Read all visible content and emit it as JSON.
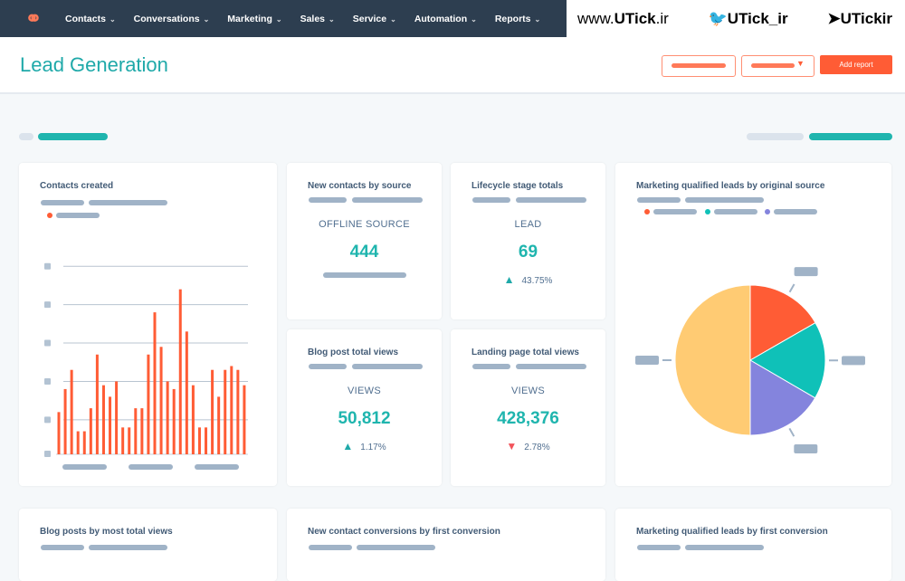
{
  "nav": {
    "logo_icon": "hubspot-sprocket-icon",
    "items": [
      "Contacts",
      "Conversations",
      "Marketing",
      "Sales",
      "Service",
      "Automation",
      "Reports"
    ]
  },
  "watermark": {
    "site_prefix": "www.",
    "site_bold": "UTick",
    "site_suffix": ".ir",
    "twitter": "UTick_ir",
    "telegram": "UTickir"
  },
  "header": {
    "title": "Lead Generation",
    "add_report": "Add report"
  },
  "colors": {
    "accent": "#1fb5ae",
    "orange": "#ff5c35",
    "teal": "#0fc1b8",
    "purple": "#8484dd",
    "yellow": "#ffcb73"
  },
  "cards": {
    "contacts_created": {
      "title": "Contacts created"
    },
    "new_contacts": {
      "title": "New contacts by source",
      "label": "OFFLINE SOURCE",
      "value": "444"
    },
    "lifecycle": {
      "title": "Lifecycle stage totals",
      "label": "LEAD",
      "value": "69",
      "change": "43.75%",
      "direction": "up"
    },
    "blog_views": {
      "title": "Blog post total views",
      "label": "VIEWS",
      "value": "50,812",
      "change": "1.17%",
      "direction": "up"
    },
    "landing_views": {
      "title": "Landing page total views",
      "label": "VIEWS",
      "value": "428,376",
      "change": "2.78%",
      "direction": "down"
    },
    "mql_source": {
      "title": "Marketing qualified leads by original source"
    },
    "blog_posts": {
      "title": "Blog posts by most total views"
    },
    "conversions": {
      "title": "New contact conversions by first conversion"
    },
    "mql_first": {
      "title": "Marketing qualified leads by first conversion"
    }
  },
  "chart_data": [
    {
      "type": "bar",
      "title": "Contacts created",
      "ylim": [
        0,
        5
      ],
      "grid": true,
      "color": "#ff5c35",
      "values": [
        1.1,
        1.7,
        2.2,
        0.6,
        0.6,
        1.2,
        2.6,
        1.8,
        1.5,
        1.9,
        0.7,
        0.7,
        1.2,
        1.2,
        2.6,
        3.7,
        2.8,
        1.9,
        1.7,
        4.3,
        3.2,
        1.8,
        0.7,
        0.7,
        2.2,
        1.5,
        2.2,
        2.3,
        2.2,
        1.8
      ]
    },
    {
      "type": "pie",
      "title": "Marketing qualified leads by original source",
      "values": [
        16.7,
        16.7,
        16.6,
        50
      ],
      "colors": [
        "#ff5c35",
        "#0fc1b8",
        "#8484dd",
        "#ffcb73"
      ]
    }
  ]
}
